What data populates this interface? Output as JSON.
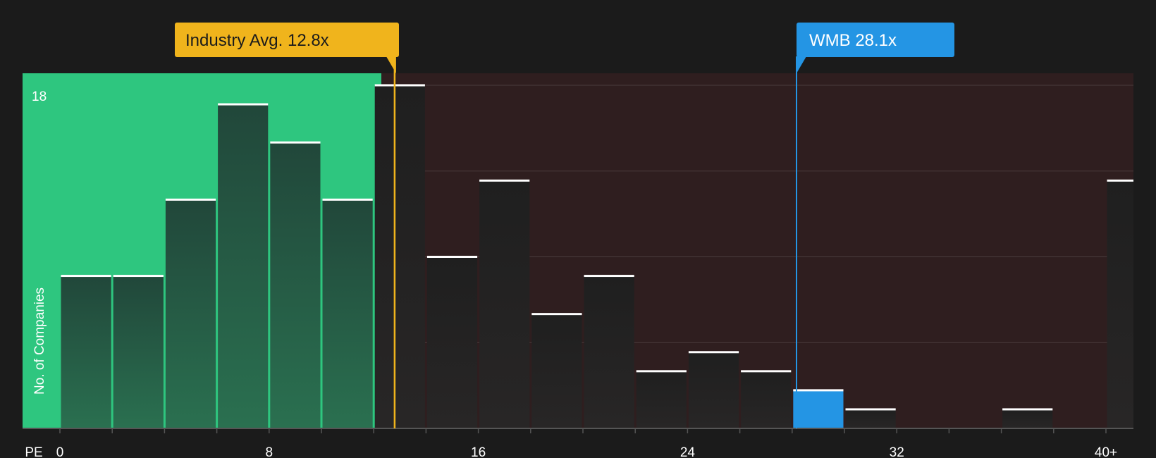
{
  "chart_data": {
    "type": "bar",
    "xlabel": "PE",
    "ylabel": "No. of Companies",
    "x_tick_labels": [
      "0",
      "8",
      "16",
      "24",
      "32",
      "40+"
    ],
    "x_tick_values": [
      0,
      8,
      16,
      24,
      32,
      40
    ],
    "xlim": [
      0,
      41
    ],
    "ylim": [
      0,
      18
    ],
    "y_tick_labels": [
      {
        "value": 18,
        "label": "18"
      }
    ],
    "bin_width": 2,
    "bins": [
      {
        "x0": 0,
        "value": 8
      },
      {
        "x0": 2,
        "value": 8
      },
      {
        "x0": 4,
        "value": 12
      },
      {
        "x0": 6,
        "value": 17
      },
      {
        "x0": 8,
        "value": 15
      },
      {
        "x0": 10,
        "value": 12
      },
      {
        "x0": 12,
        "value": 18
      },
      {
        "x0": 14,
        "value": 9
      },
      {
        "x0": 16,
        "value": 13
      },
      {
        "x0": 18,
        "value": 6
      },
      {
        "x0": 20,
        "value": 8
      },
      {
        "x0": 22,
        "value": 3
      },
      {
        "x0": 24,
        "value": 4
      },
      {
        "x0": 26,
        "value": 3
      },
      {
        "x0": 28,
        "value": 2
      },
      {
        "x0": 30,
        "value": 1
      },
      {
        "x0": 36,
        "value": 1
      },
      {
        "x0": 40,
        "value": 13
      }
    ],
    "highlight_bin_x0": 28,
    "markers": [
      {
        "name": "industry-avg",
        "label": "Industry Avg. 12.8x",
        "value": 12.8,
        "color": "#f0b41c",
        "text_color": "#1b1b1b"
      },
      {
        "name": "company",
        "label": "WMB 28.1x",
        "value": 28.1,
        "color": "#2495e4",
        "text_color": "#ffffff"
      }
    ],
    "grid": true,
    "colors": {
      "background": "#1b1b1b",
      "good_zone": "#2ec67f",
      "bad_zone": "#2f1e1f",
      "bar_green": "#23513b",
      "bar_dark": "#232323",
      "highlight": "#2495e4",
      "cap": "#ffffff",
      "gridline": "#4a3c3d",
      "axis": "#555555"
    }
  }
}
